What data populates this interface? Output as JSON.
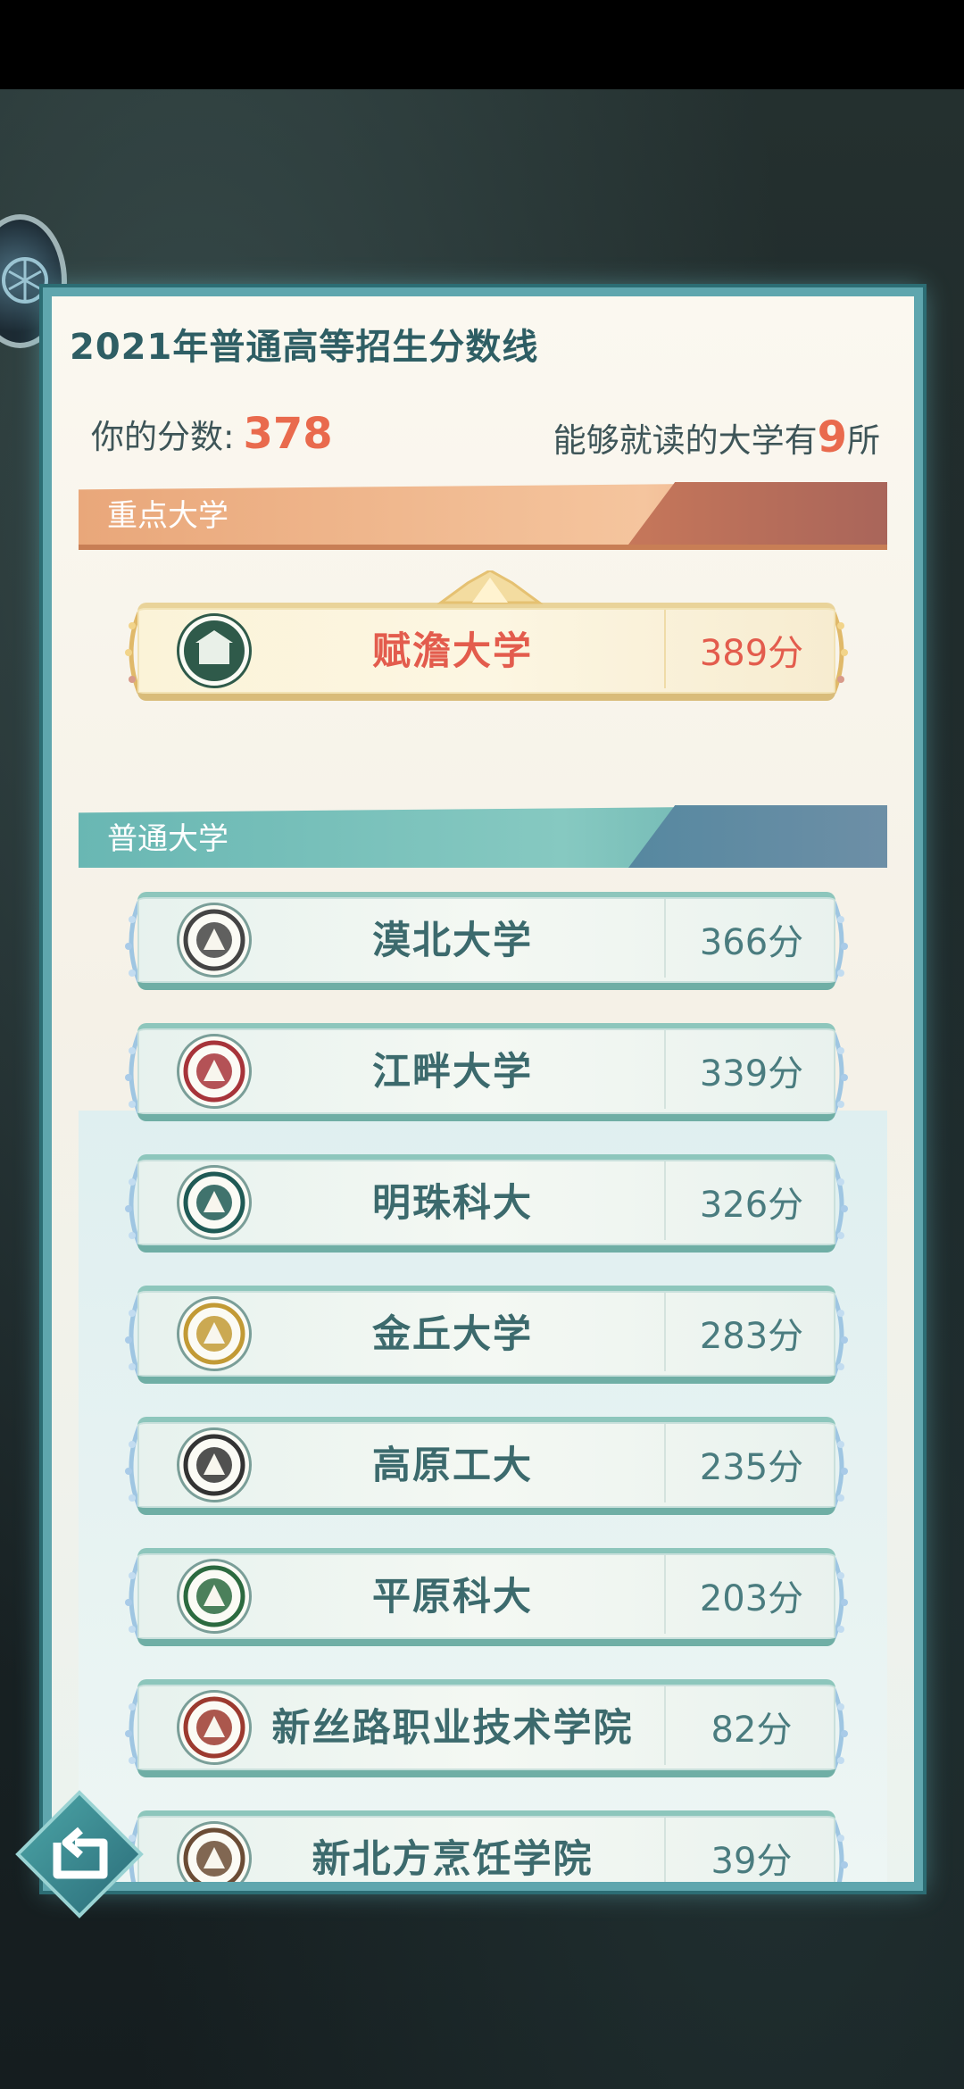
{
  "page": {
    "title": "2021年普通高等招生分数线",
    "score_label": "你的分数:",
    "score_value": "378",
    "can_read_prefix": "能够就读的大学有",
    "can_read_count": "9",
    "can_read_suffix": "所"
  },
  "sections": {
    "key": "重点大学",
    "normal": "普通大学"
  },
  "key_universities": [
    {
      "name": "赋澹大学",
      "score": "389分",
      "logo_color": "#2f5a4a"
    }
  ],
  "universities": [
    {
      "name": "漠北大学",
      "score": "366分",
      "logo_color": "#444444"
    },
    {
      "name": "江畔大学",
      "score": "339分",
      "logo_color": "#a7343a"
    },
    {
      "name": "明珠科大",
      "score": "326分",
      "logo_color": "#1f5a55"
    },
    {
      "name": "金丘大学",
      "score": "283分",
      "logo_color": "#c29a35"
    },
    {
      "name": "高原工大",
      "score": "235分",
      "logo_color": "#333333"
    },
    {
      "name": "平原科大",
      "score": "203分",
      "logo_color": "#2c6a3f"
    },
    {
      "name": "新丝路职业技术学院",
      "score": "82分",
      "logo_color": "#9c3a2f"
    },
    {
      "name": "新北方烹饪学院",
      "score": "39分",
      "logo_color": "#6b4c35"
    }
  ],
  "colors": {
    "accent_red": "#e96a4d",
    "teal": "#5fa6ae",
    "title_teal": "#2e5e64"
  },
  "icons": {
    "back": "back-arrow-icon",
    "avatar": "avatar-icon"
  }
}
